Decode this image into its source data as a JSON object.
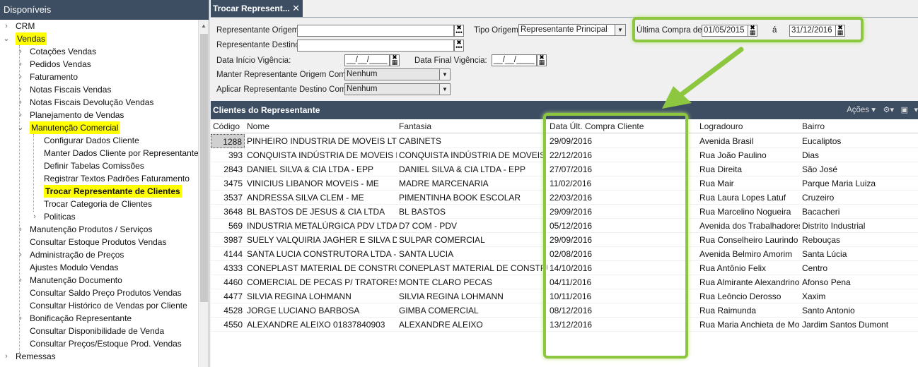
{
  "left_panel": {
    "title": "Disponíveis"
  },
  "tree": [
    {
      "label": "CRM",
      "level": 0,
      "toggle": ">",
      "hl": false
    },
    {
      "label": "Vendas",
      "level": 0,
      "toggle": "v",
      "hl": true
    },
    {
      "label": "Cotações Vendas",
      "level": 1,
      "toggle": ">",
      "hl": false
    },
    {
      "label": "Pedidos Vendas",
      "level": 1,
      "toggle": ">",
      "hl": false
    },
    {
      "label": "Faturamento",
      "level": 1,
      "toggle": ">",
      "hl": false
    },
    {
      "label": "Notas Fiscais Vendas",
      "level": 1,
      "toggle": ">",
      "hl": false
    },
    {
      "label": "Notas Fiscais Devolução Vendas",
      "level": 1,
      "toggle": ">",
      "hl": false
    },
    {
      "label": "Planejamento de Vendas",
      "level": 1,
      "toggle": ">",
      "hl": false
    },
    {
      "label": "Manutenção Comercial",
      "level": 1,
      "toggle": "v",
      "hl": true
    },
    {
      "label": "Configurar Dados Cliente",
      "level": 2,
      "toggle": "",
      "hl": false
    },
    {
      "label": "Manter Dados Cliente por Representante",
      "level": 2,
      "toggle": "",
      "hl": false
    },
    {
      "label": "Definir Tabelas Comissões",
      "level": 2,
      "toggle": "",
      "hl": false
    },
    {
      "label": "Registrar Textos Padrões Faturamento",
      "level": 2,
      "toggle": "",
      "hl": false
    },
    {
      "label": "Trocar Representante de Clientes",
      "level": 2,
      "toggle": "",
      "hl": true,
      "bold": true
    },
    {
      "label": "Trocar Categoria de Clientes",
      "level": 2,
      "toggle": "",
      "hl": false
    },
    {
      "label": "Politicas",
      "level": 2,
      "toggle": ">",
      "hl": false
    },
    {
      "label": "Manutenção Produtos / Serviços",
      "level": 1,
      "toggle": ">",
      "hl": false
    },
    {
      "label": "Consultar Estoque Produtos Vendas",
      "level": 1,
      "toggle": "",
      "hl": false
    },
    {
      "label": "Administração de Preços",
      "level": 1,
      "toggle": ">",
      "hl": false
    },
    {
      "label": "Ajustes Modulo Vendas",
      "level": 1,
      "toggle": "",
      "hl": false
    },
    {
      "label": "Manutenção Documento",
      "level": 1,
      "toggle": ">",
      "hl": false
    },
    {
      "label": "Consultar Saldo Preço Produtos Vendas",
      "level": 1,
      "toggle": "",
      "hl": false
    },
    {
      "label": "Consultar Histórico de Vendas por Cliente",
      "level": 1,
      "toggle": "",
      "hl": false
    },
    {
      "label": "Bonificação Representante",
      "level": 1,
      "toggle": ">",
      "hl": false
    },
    {
      "label": "Consultar Disponibilidade de Venda",
      "level": 1,
      "toggle": "",
      "hl": false
    },
    {
      "label": "Consultar Preços/Estoque Prod. Vendas",
      "level": 1,
      "toggle": "",
      "hl": false
    },
    {
      "label": "Remessas",
      "level": 0,
      "toggle": ">",
      "hl": false
    }
  ],
  "tab": {
    "title": "Trocar Represent...",
    "close": "✕"
  },
  "form": {
    "rep_origem_label": "Representante Origem:",
    "rep_origem_value": "",
    "rep_destino_label": "Representante Destino:",
    "rep_destino_value": "",
    "tipo_origem_label": "Tipo Origem:",
    "tipo_origem_value": "Representante Principal",
    "ultima_compra_label": "Última Compra de:",
    "ultima_compra_de": "01/05/2015",
    "ultima_compra_sep": "á",
    "ultima_compra_ate": "31/12/2016",
    "data_inicio_label": "Data Início Vigência:",
    "data_inicio_value": "__/__/____",
    "data_final_label": "Data Final Vigência:",
    "data_final_value": "__/__/____",
    "manter_label": "Manter Representante Origem Como:",
    "manter_value": "Nenhum",
    "aplicar_label": "Aplicar Representante Destino Como:",
    "aplicar_value": "Nenhum"
  },
  "grid": {
    "title": "Clientes do Representante",
    "actions_label": "Ações",
    "columns": [
      "Código",
      "Nome",
      "Fantasia",
      "Data Últ. Compra Cliente",
      "Logradouro",
      "Bairro"
    ],
    "rows": [
      [
        "1288",
        "PINHEIRO INDUSTRIA DE MOVEIS LTDA",
        "CABINETS",
        "29/09/2016",
        "Avenida Brasil",
        "Eucaliptos"
      ],
      [
        "393",
        "CONQUISTA INDÚSTRIA DE MOVEIS LTDA",
        "CONQUISTA INDÚSTRIA DE MOVEIS",
        "22/12/2016",
        "Rua João Paulino",
        "Dias"
      ],
      [
        "2843",
        "DANIEL SILVA & CIA LTDA - EPP",
        "DANIEL SILVA & CIA LTDA - EPP",
        "27/07/2016",
        "Rua Direita",
        "São José"
      ],
      [
        "3475",
        "VINICIUS LIBANOR MOVEIS - ME",
        "MADRE MARCENARIA",
        "11/02/2016",
        "Rua Mair",
        "Parque Maria Luiza"
      ],
      [
        "3537",
        "ANDRESSA SILVA CLEM - ME",
        "PIMENTINHA BOOK ESCOLAR",
        "22/03/2016",
        "Rua Laura Lopes Latuf",
        "Cruzeiro"
      ],
      [
        "3648",
        "BL BASTOS DE JESUS & CIA LTDA",
        "BL BASTOS",
        "29/09/2016",
        "Rua Marcelino Nogueira",
        "Bacacheri"
      ],
      [
        "569",
        "INDUSTRIA METALÚRGICA PDV LTDA",
        "D7 COM - PDV",
        "05/12/2016",
        "Avenida dos Trabalhadores",
        "Distrito Industrial"
      ],
      [
        "3987",
        "SUELY VALQUIRIA JAGHER E SILVA D",
        "SULPAR COMERCIAL",
        "29/09/2016",
        "Rua Conselheiro Laurindo",
        "Rebouças"
      ],
      [
        "4144",
        "SANTA LUCIA CONSTRUTORA LTDA - ME",
        "SANTA LUCIA",
        "02/08/2016",
        "Avenida Belmiro Amorim",
        "Santa Lúcia"
      ],
      [
        "4333",
        "CONEPLAST MATERIAL DE CONSTRUÇÃO",
        "CONEPLAST MATERIAL DE CONSTRUÇÃO",
        "14/10/2016",
        "Rua Antônio Felix",
        "Centro"
      ],
      [
        "4460",
        "COMERCIAL DE PECAS P/ TRATORES",
        "MONTE CLARO PECAS",
        "04/11/2016",
        "Rua Almirante Alexandrino",
        "Afonso Pena"
      ],
      [
        "4477",
        "SILVIA REGINA LOHMANN",
        "SILVIA REGINA LOHMANN",
        "10/11/2016",
        "Rua Leôncio Derosso",
        "Xaxim"
      ],
      [
        "4528",
        "JORGE LUCIANO BARBOSA",
        "GIMBA COMERCIAL",
        "08/12/2016",
        "Rua Raimunda",
        "Santo Antonio"
      ],
      [
        "4550",
        "ALEXANDRE ALEIXO 01837840903",
        "ALEXANDRE ALEIXO",
        "13/12/2016",
        "Rua Maria Anchieta de Moraes",
        "Jardim Santos Dumont"
      ]
    ]
  }
}
